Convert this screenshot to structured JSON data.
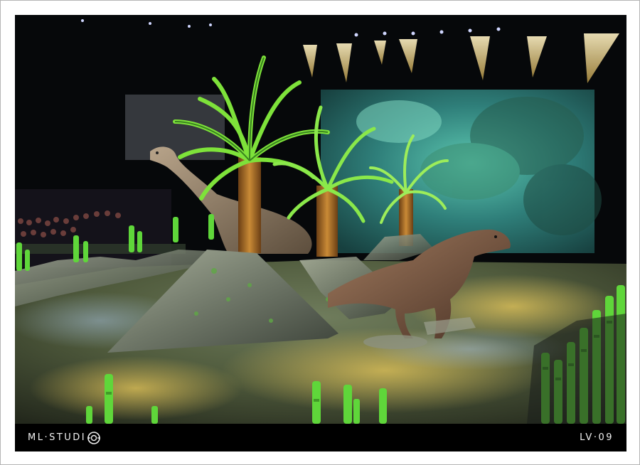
{
  "watermark": {
    "studio": "ML·STUDI",
    "logo_icon": "camera-lens-icon",
    "code": "LV·09"
  },
  "colors": {
    "frame_border": "#b5b5b5",
    "photo_border": "#050505",
    "caption_text": "#f0f0f0",
    "palm_green": "#7ee23a",
    "backdrop_teal": "#3fa9a0"
  }
}
